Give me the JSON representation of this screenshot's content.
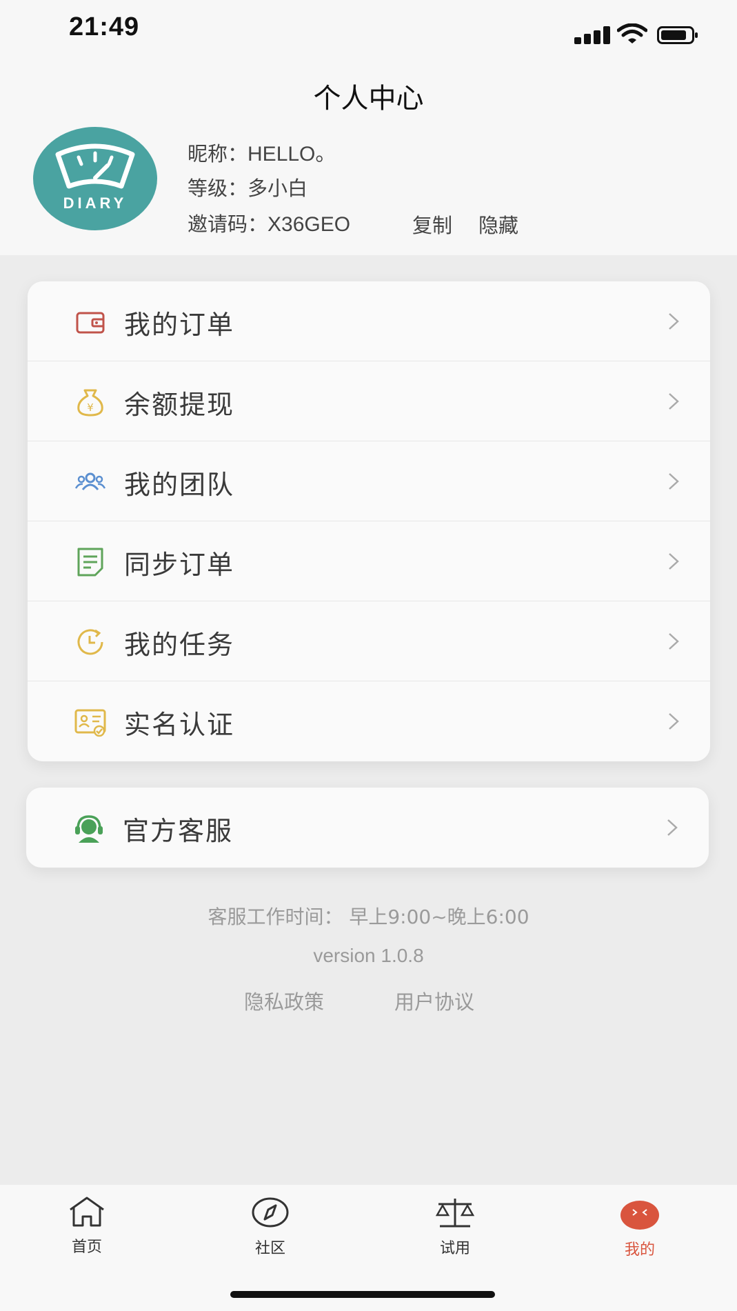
{
  "status_bar": {
    "time": "21:49"
  },
  "header": {
    "title": "个人中心"
  },
  "profile": {
    "avatar_text": "DIARY",
    "nickname_label": "昵称：",
    "nickname": "HELLO。",
    "level_label": "等级：",
    "level": "多小白",
    "invite_label": "邀请码：",
    "invite_code": "X36GEO",
    "copy_label": "复制",
    "hide_label": "隐藏"
  },
  "menu": {
    "items": [
      {
        "label": "我的订单",
        "icon": "wallet-icon",
        "color": "#c0534a"
      },
      {
        "label": "余额提现",
        "icon": "money-bag-icon",
        "color": "#e0b84a"
      },
      {
        "label": "我的团队",
        "icon": "team-icon",
        "color": "#5b8fd0"
      },
      {
        "label": "同步订单",
        "icon": "document-icon",
        "color": "#5fa45a"
      },
      {
        "label": "我的任务",
        "icon": "clock-icon",
        "color": "#e0b84a"
      },
      {
        "label": "实名认证",
        "icon": "id-card-icon",
        "color": "#e0b84a"
      }
    ]
  },
  "service": {
    "label": "官方客服",
    "icon": "headset-icon",
    "color": "#4aa158"
  },
  "info": {
    "hours": "客服工作时间：  早上9:00~晚上6:00",
    "version": "version 1.0.8",
    "privacy": "隐私政策",
    "agreement": "用户协议"
  },
  "tabbar": {
    "tabs": [
      {
        "label": "首页",
        "icon": "home-icon"
      },
      {
        "label": "社区",
        "icon": "compass-icon"
      },
      {
        "label": "试用",
        "icon": "scale-icon"
      },
      {
        "label": "我的",
        "icon": "profile-face-icon",
        "active": true
      }
    ],
    "active_color": "#d9553e"
  }
}
